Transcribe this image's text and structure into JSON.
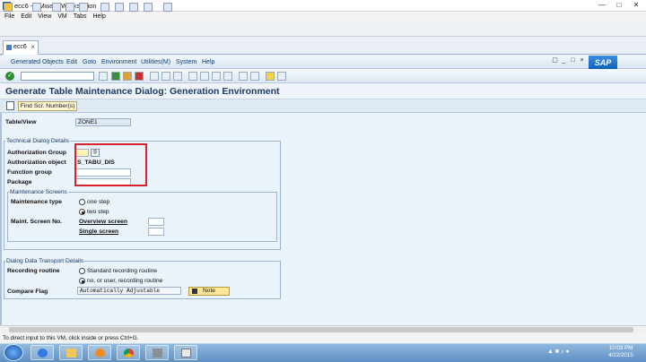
{
  "window": {
    "title": "ecc6 - VMware Workstation",
    "controls": [
      "minimize-icon",
      "maximize-icon",
      "close-icon"
    ]
  },
  "vm_menu": [
    "File",
    "Edit",
    "View",
    "VM",
    "Tabs",
    "Help"
  ],
  "vm_tab": {
    "label": "ecc6"
  },
  "sap_menu": [
    "Generated Objects",
    "Edit",
    "Goto",
    "Environment",
    "Utilities(M)",
    "System",
    "Help"
  ],
  "sap_logo": "SAP",
  "screen_title": "Generate Table Maintenance Dialog: Generation Environment",
  "app_toolbar": {
    "find_button": "Find Scr. Number(s)"
  },
  "table_view": {
    "label": "Table/View",
    "value": "ZONE1"
  },
  "technical": {
    "title": "Technical Dialog Details",
    "auth_group_label": "Authorization Group",
    "auth_group_value": "",
    "auth_object_label": "Authorization object",
    "auth_object_value": "S_TABU_DIS",
    "function_group_label": "Function group",
    "function_group_value": "",
    "package_label": "Package",
    "package_value": ""
  },
  "maintenance": {
    "title": "Maintenance Screens",
    "type_label": "Maintenance type",
    "option_one": "one step",
    "option_two": "two step",
    "selected": "two step",
    "screen_no_label": "Maint. Screen No.",
    "overview_label": "Overview screen",
    "overview_value": "",
    "single_label": "Single screen",
    "single_value": ""
  },
  "transport": {
    "title": "Dialog Data Transport Details",
    "recording_label": "Recording routine",
    "option_standard": "Standard recording routine",
    "option_user": "no, or user, recording routine",
    "selected": "no, or user, recording routine",
    "compare_label": "Compare Flag",
    "compare_value": "Automatically Adjustable",
    "note_button": "Note"
  },
  "status_bar": "To direct input to this VM, click inside or press Ctrl+G.",
  "taskbar": {
    "time": "10:03 PM",
    "date": "4/22/2015"
  }
}
